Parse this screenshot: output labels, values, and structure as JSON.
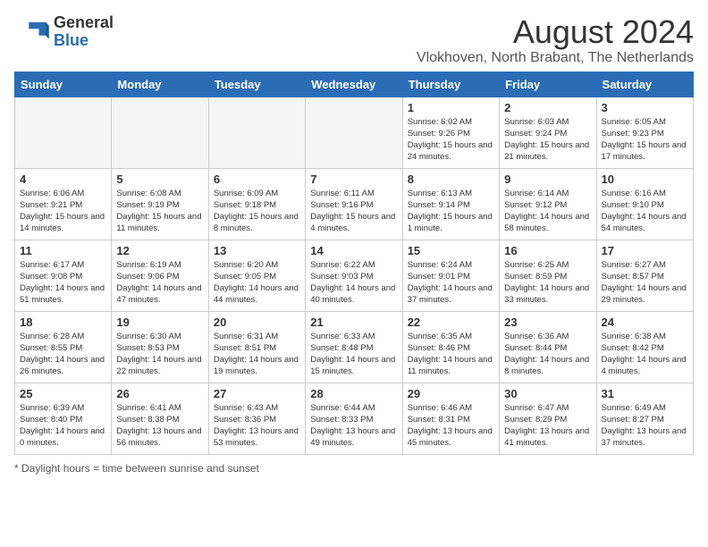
{
  "logo": {
    "general": "General",
    "blue": "Blue"
  },
  "title": {
    "month_year": "August 2024",
    "location": "Vlokhoven, North Brabant, The Netherlands"
  },
  "days_of_week": [
    "Sunday",
    "Monday",
    "Tuesday",
    "Wednesday",
    "Thursday",
    "Friday",
    "Saturday"
  ],
  "footer": {
    "note": "Daylight hours"
  },
  "weeks": [
    [
      {
        "day": "",
        "info": ""
      },
      {
        "day": "",
        "info": ""
      },
      {
        "day": "",
        "info": ""
      },
      {
        "day": "",
        "info": ""
      },
      {
        "day": "1",
        "info": "Sunrise: 6:02 AM\nSunset: 9:26 PM\nDaylight: 15 hours\nand 24 minutes."
      },
      {
        "day": "2",
        "info": "Sunrise: 6:03 AM\nSunset: 9:24 PM\nDaylight: 15 hours\nand 21 minutes."
      },
      {
        "day": "3",
        "info": "Sunrise: 6:05 AM\nSunset: 9:23 PM\nDaylight: 15 hours\nand 17 minutes."
      }
    ],
    [
      {
        "day": "4",
        "info": "Sunrise: 6:06 AM\nSunset: 9:21 PM\nDaylight: 15 hours\nand 14 minutes."
      },
      {
        "day": "5",
        "info": "Sunrise: 6:08 AM\nSunset: 9:19 PM\nDaylight: 15 hours\nand 11 minutes."
      },
      {
        "day": "6",
        "info": "Sunrise: 6:09 AM\nSunset: 9:18 PM\nDaylight: 15 hours\nand 8 minutes."
      },
      {
        "day": "7",
        "info": "Sunrise: 6:11 AM\nSunset: 9:16 PM\nDaylight: 15 hours\nand 4 minutes."
      },
      {
        "day": "8",
        "info": "Sunrise: 6:13 AM\nSunset: 9:14 PM\nDaylight: 15 hours\nand 1 minute."
      },
      {
        "day": "9",
        "info": "Sunrise: 6:14 AM\nSunset: 9:12 PM\nDaylight: 14 hours\nand 58 minutes."
      },
      {
        "day": "10",
        "info": "Sunrise: 6:16 AM\nSunset: 9:10 PM\nDaylight: 14 hours\nand 54 minutes."
      }
    ],
    [
      {
        "day": "11",
        "info": "Sunrise: 6:17 AM\nSunset: 9:08 PM\nDaylight: 14 hours\nand 51 minutes."
      },
      {
        "day": "12",
        "info": "Sunrise: 6:19 AM\nSunset: 9:06 PM\nDaylight: 14 hours\nand 47 minutes."
      },
      {
        "day": "13",
        "info": "Sunrise: 6:20 AM\nSunset: 9:05 PM\nDaylight: 14 hours\nand 44 minutes."
      },
      {
        "day": "14",
        "info": "Sunrise: 6:22 AM\nSunset: 9:03 PM\nDaylight: 14 hours\nand 40 minutes."
      },
      {
        "day": "15",
        "info": "Sunrise: 6:24 AM\nSunset: 9:01 PM\nDaylight: 14 hours\nand 37 minutes."
      },
      {
        "day": "16",
        "info": "Sunrise: 6:25 AM\nSunset: 8:59 PM\nDaylight: 14 hours\nand 33 minutes."
      },
      {
        "day": "17",
        "info": "Sunrise: 6:27 AM\nSunset: 8:57 PM\nDaylight: 14 hours\nand 29 minutes."
      }
    ],
    [
      {
        "day": "18",
        "info": "Sunrise: 6:28 AM\nSunset: 8:55 PM\nDaylight: 14 hours\nand 26 minutes."
      },
      {
        "day": "19",
        "info": "Sunrise: 6:30 AM\nSunset: 8:53 PM\nDaylight: 14 hours\nand 22 minutes."
      },
      {
        "day": "20",
        "info": "Sunrise: 6:31 AM\nSunset: 8:51 PM\nDaylight: 14 hours\nand 19 minutes."
      },
      {
        "day": "21",
        "info": "Sunrise: 6:33 AM\nSunset: 8:48 PM\nDaylight: 14 hours\nand 15 minutes."
      },
      {
        "day": "22",
        "info": "Sunrise: 6:35 AM\nSunset: 8:46 PM\nDaylight: 14 hours\nand 11 minutes."
      },
      {
        "day": "23",
        "info": "Sunrise: 6:36 AM\nSunset: 8:44 PM\nDaylight: 14 hours\nand 8 minutes."
      },
      {
        "day": "24",
        "info": "Sunrise: 6:38 AM\nSunset: 8:42 PM\nDaylight: 14 hours\nand 4 minutes."
      }
    ],
    [
      {
        "day": "25",
        "info": "Sunrise: 6:39 AM\nSunset: 8:40 PM\nDaylight: 14 hours\nand 0 minutes."
      },
      {
        "day": "26",
        "info": "Sunrise: 6:41 AM\nSunset: 8:38 PM\nDaylight: 13 hours\nand 56 minutes."
      },
      {
        "day": "27",
        "info": "Sunrise: 6:43 AM\nSunset: 8:36 PM\nDaylight: 13 hours\nand 53 minutes."
      },
      {
        "day": "28",
        "info": "Sunrise: 6:44 AM\nSunset: 8:33 PM\nDaylight: 13 hours\nand 49 minutes."
      },
      {
        "day": "29",
        "info": "Sunrise: 6:46 AM\nSunset: 8:31 PM\nDaylight: 13 hours\nand 45 minutes."
      },
      {
        "day": "30",
        "info": "Sunrise: 6:47 AM\nSunset: 8:29 PM\nDaylight: 13 hours\nand 41 minutes."
      },
      {
        "day": "31",
        "info": "Sunrise: 6:49 AM\nSunset: 8:27 PM\nDaylight: 13 hours\nand 37 minutes."
      }
    ]
  ]
}
